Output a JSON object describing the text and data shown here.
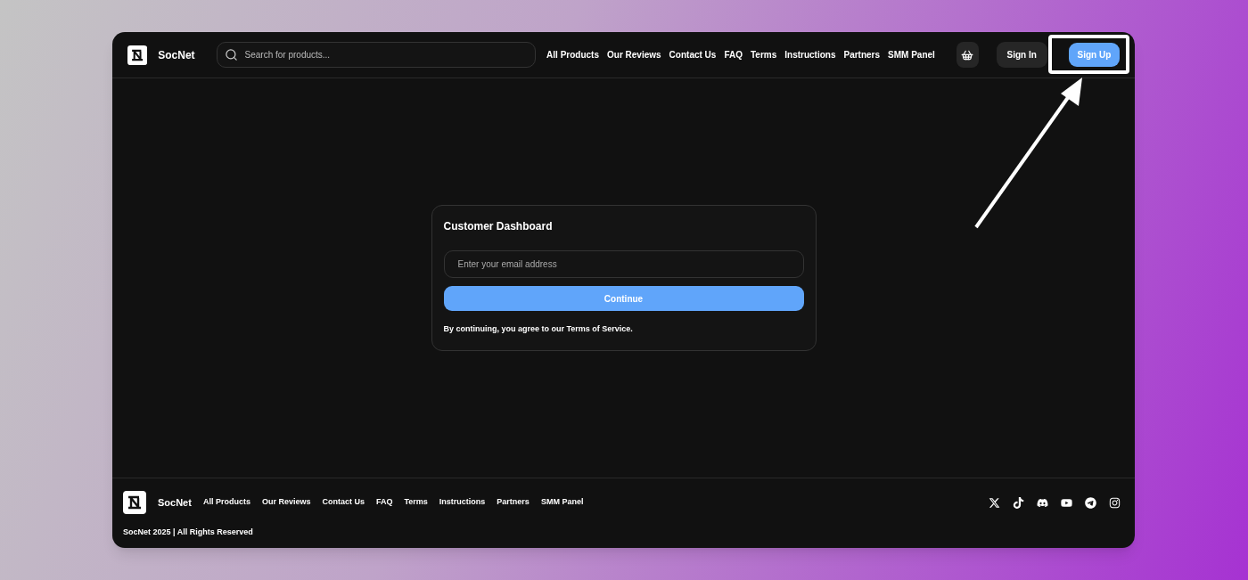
{
  "header": {
    "brand": "SocNet",
    "search": {
      "placeholder": "Search for products..."
    },
    "nav": [
      "All Products",
      "Our Reviews",
      "Contact Us",
      "FAQ",
      "Terms",
      "Instructions",
      "Partners",
      "SMM Panel"
    ],
    "sign_in": "Sign In",
    "sign_up": "Sign Up"
  },
  "card": {
    "title": "Customer Dashboard",
    "email": {
      "placeholder": "Enter your email address"
    },
    "button": "Continue",
    "note": "By continuing, you agree to our Terms of Service."
  },
  "footer": {
    "brand": "SocNet",
    "links": [
      "All Products",
      "Our Reviews",
      "Contact Us",
      "FAQ",
      "Terms",
      "Instructions",
      "Partners",
      "SMM Panel"
    ],
    "copyright": "SocNet 2025 | All Rights Reserved"
  }
}
